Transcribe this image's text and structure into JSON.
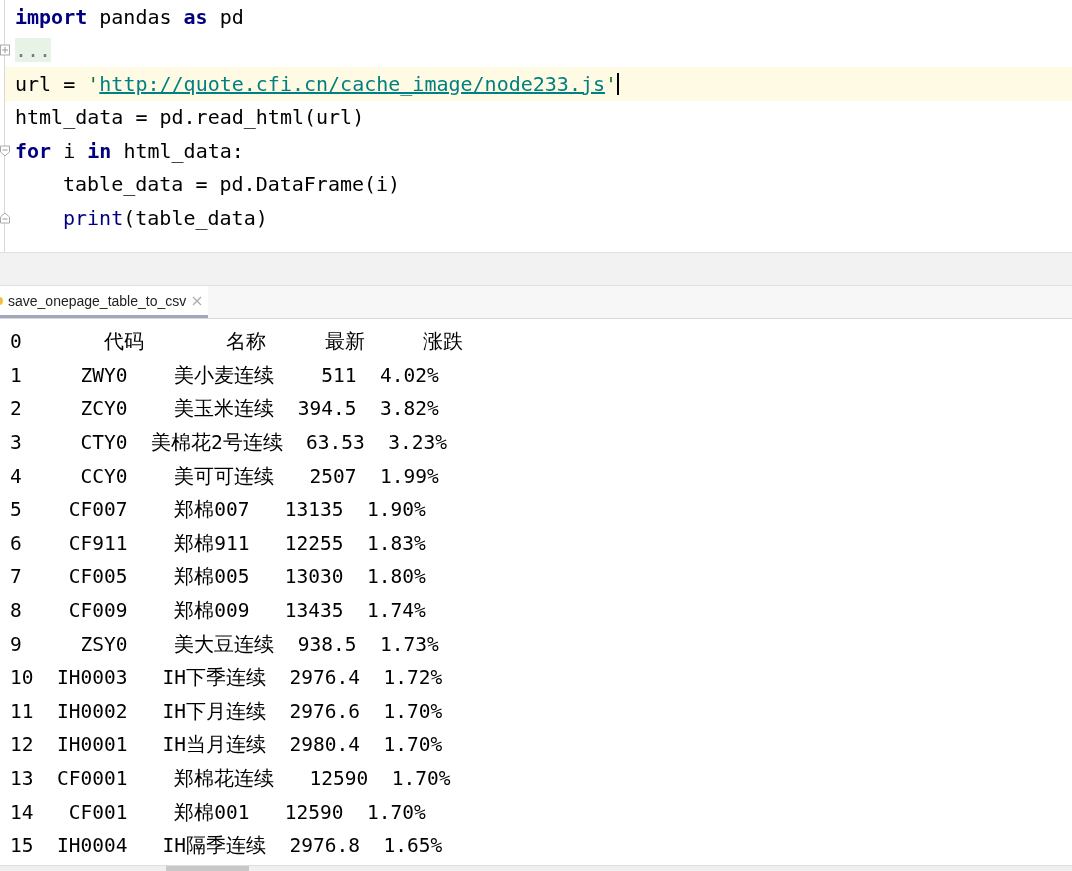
{
  "editor": {
    "lines": [
      {
        "current": false,
        "indented": false,
        "kind": "plain",
        "tokens": [
          {
            "kind": "keyword",
            "text": "import"
          },
          {
            "kind": "plain",
            "text": " pandas "
          },
          {
            "kind": "keyword",
            "text": "as"
          },
          {
            "kind": "plain",
            "text": " pd"
          }
        ]
      },
      {
        "current": false,
        "indented": false,
        "kind": "fold_collapsed",
        "tokens": [
          {
            "kind": "folded",
            "text": "..."
          }
        ]
      },
      {
        "current": true,
        "indented": false,
        "kind": "plain",
        "tokens": [
          {
            "kind": "plain",
            "text": "url = "
          },
          {
            "kind": "string",
            "text": "'"
          },
          {
            "kind": "url",
            "text": "http://quote.cfi.cn/cache_image/node233.js"
          },
          {
            "kind": "string",
            "text": "'"
          }
        ]
      },
      {
        "current": false,
        "indented": false,
        "kind": "plain",
        "tokens": [
          {
            "kind": "plain",
            "text": "html_data = pd.read_html(url)"
          }
        ]
      },
      {
        "current": false,
        "indented": false,
        "kind": "fold_start",
        "tokens": [
          {
            "kind": "keyword",
            "text": "for"
          },
          {
            "kind": "plain",
            "text": " i "
          },
          {
            "kind": "keyword",
            "text": "in"
          },
          {
            "kind": "plain",
            "text": " html_data:"
          }
        ]
      },
      {
        "current": false,
        "indented": true,
        "kind": "plain",
        "tokens": [
          {
            "kind": "plain",
            "text": "table_data = pd.DataFrame(i)"
          }
        ]
      },
      {
        "current": false,
        "indented": true,
        "kind": "fold_end",
        "tokens": [
          {
            "kind": "builtin",
            "text": "print"
          },
          {
            "kind": "plain",
            "text": "(table_data)"
          }
        ]
      }
    ]
  },
  "run_tabs": [
    {
      "label": "save_onepage_table_to_csv",
      "selected": true
    }
  ],
  "console": {
    "lines": [
      "0       代码       名称     最新     涨跌",
      "1     ZWY0    美小麦连续    511  4.02%",
      "2     ZCY0    美玉米连续  394.5  3.82%",
      "3     CTY0  美棉花2号连续  63.53  3.23%",
      "4     CCY0    美可可连续   2507  1.99%",
      "5    CF007    郑棉007   13135  1.90%",
      "6    CF911    郑棉911   12255  1.83%",
      "7    CF005    郑棉005   13030  1.80%",
      "8    CF009    郑棉009   13435  1.74%",
      "9     ZSY0    美大豆连续  938.5  1.73%",
      "10  IH0003   IH下季连续  2976.4  1.72%",
      "11  IH0002   IH下月连续  2976.6  1.70%",
      "12  IH0001   IH当月连续  2980.4  1.70%",
      "13  CF0001    郑棉花连续   12590  1.70%",
      "14   CF001    郑棉001   12590  1.70%",
      "15  IH0004   IH隔季连续  2976.8  1.65%"
    ]
  }
}
